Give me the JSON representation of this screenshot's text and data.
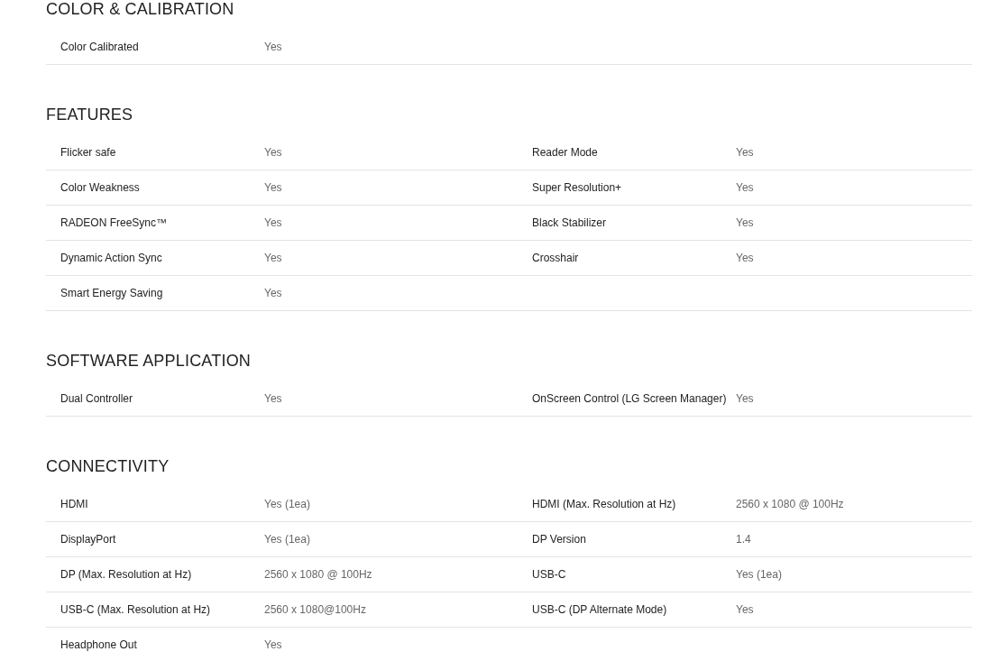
{
  "sections": [
    {
      "title": "COLOR & CALIBRATION",
      "rows": [
        [
          {
            "label": "Color Calibrated",
            "value": "Yes"
          }
        ]
      ]
    },
    {
      "title": "FEATURES",
      "rows": [
        [
          {
            "label": "Flicker safe",
            "value": "Yes"
          },
          {
            "label": "Reader Mode",
            "value": "Yes"
          }
        ],
        [
          {
            "label": "Color Weakness",
            "value": "Yes"
          },
          {
            "label": "Super Resolution+",
            "value": "Yes"
          }
        ],
        [
          {
            "label": "RADEON FreeSync™",
            "value": "Yes"
          },
          {
            "label": "Black Stabilizer",
            "value": "Yes"
          }
        ],
        [
          {
            "label": "Dynamic Action Sync",
            "value": "Yes"
          },
          {
            "label": "Crosshair",
            "value": "Yes"
          }
        ],
        [
          {
            "label": "Smart Energy Saving",
            "value": "Yes"
          }
        ]
      ]
    },
    {
      "title": "SOFTWARE APPLICATION",
      "rows": [
        [
          {
            "label": "Dual Controller",
            "value": "Yes"
          },
          {
            "label": "OnScreen Control (LG Screen Manager)",
            "value": "Yes"
          }
        ]
      ]
    },
    {
      "title": "CONNECTIVITY",
      "rows": [
        [
          {
            "label": "HDMI",
            "value": "Yes (1ea)"
          },
          {
            "label": "HDMI (Max. Resolution at Hz)",
            "value": "2560 x 1080 @ 100Hz"
          }
        ],
        [
          {
            "label": "DisplayPort",
            "value": "Yes (1ea)"
          },
          {
            "label": "DP Version",
            "value": "1.4"
          }
        ],
        [
          {
            "label": "DP (Max. Resolution at Hz)",
            "value": "2560 x 1080 @ 100Hz"
          },
          {
            "label": "USB-C",
            "value": "Yes (1ea)"
          }
        ],
        [
          {
            "label": "USB-C (Max. Resolution at Hz)",
            "value": "2560 x 1080@100Hz"
          },
          {
            "label": "USB-C (DP Alternate Mode)",
            "value": "Yes"
          }
        ],
        [
          {
            "label": "Headphone Out",
            "value": "Yes"
          }
        ]
      ]
    }
  ]
}
